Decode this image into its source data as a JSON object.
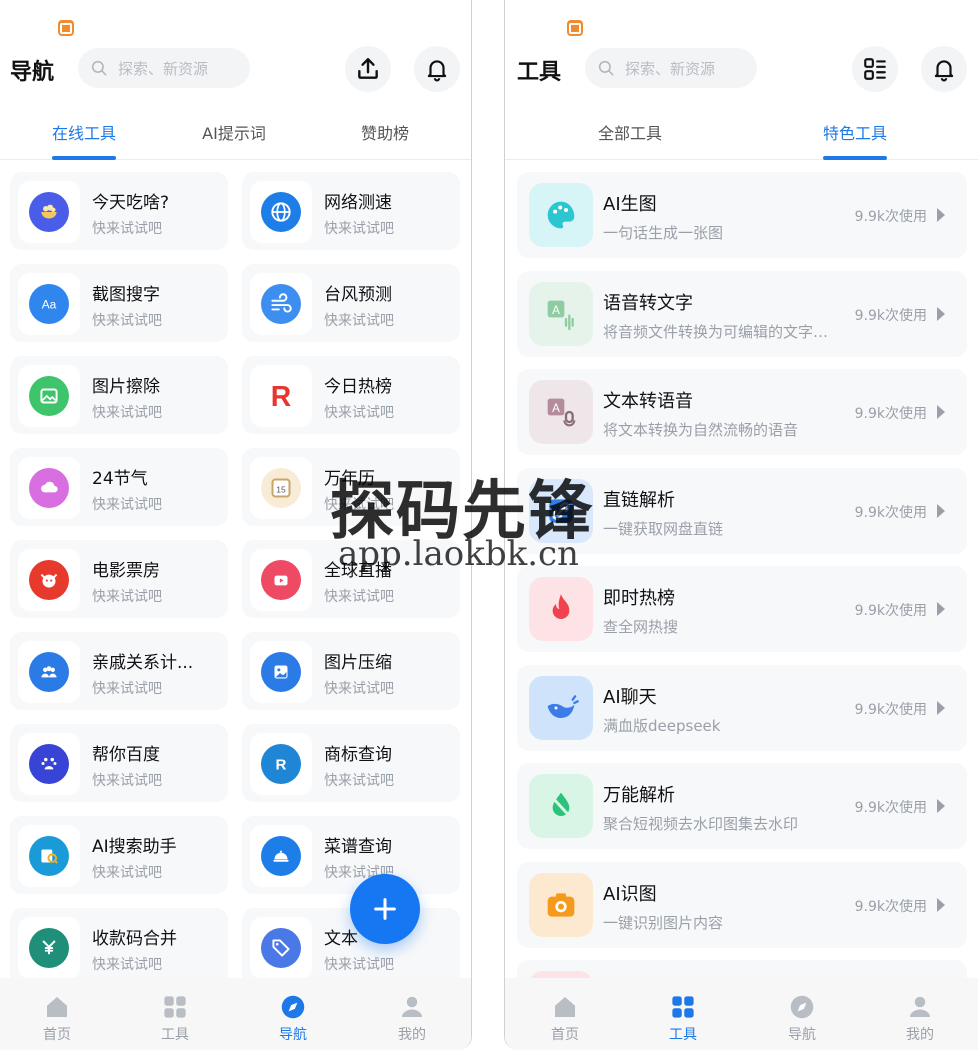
{
  "left": {
    "title": "导航",
    "search_placeholder": "探索、新资源",
    "tabs": [
      "在线工具",
      "AI提示词",
      "赞助榜"
    ],
    "active_tab": 0,
    "tools": [
      {
        "name": "今天吃啥?",
        "sub": "快来试试吧",
        "icon": "food-bowl-icon",
        "color": "#4a5de8"
      },
      {
        "name": "网络测速",
        "sub": "快来试试吧",
        "icon": "globe-icon",
        "color": "#1e7ee8"
      },
      {
        "name": "截图搜字",
        "sub": "快来试试吧",
        "icon": "text-aa-icon",
        "color": "#2f86ee"
      },
      {
        "name": "台风预测",
        "sub": "快来试试吧",
        "icon": "wind-icon",
        "color": "#3c8ef0"
      },
      {
        "name": "图片擦除",
        "sub": "快来试试吧",
        "icon": "image-erase-icon",
        "color": "#3ec46a"
      },
      {
        "name": "今日热榜",
        "sub": "快来试试吧",
        "icon": "r-logo-icon",
        "color": "#e8352d"
      },
      {
        "name": "24节气",
        "sub": "快来试试吧",
        "icon": "cloud-icon",
        "color": "#d86ee0"
      },
      {
        "name": "万年历",
        "sub": "快来试试吧",
        "icon": "calendar-icon",
        "color": "#f3e2c6"
      },
      {
        "name": "电影票房",
        "sub": "快来试试吧",
        "icon": "cat-logo-icon",
        "color": "#e83a2c"
      },
      {
        "name": "全球直播",
        "sub": "快来试试吧",
        "icon": "play-icon",
        "color": "#ef4a64"
      },
      {
        "name": "亲戚关系计...",
        "sub": "快来试试吧",
        "icon": "family-icon",
        "color": "#2a7be6"
      },
      {
        "name": "图片压缩",
        "sub": "快来试试吧",
        "icon": "image-compress-icon",
        "color": "#2a7be6"
      },
      {
        "name": "帮你百度",
        "sub": "快来试试吧",
        "icon": "baidu-paw-icon",
        "color": "#3844d6"
      },
      {
        "name": "商标查询",
        "sub": "快来试试吧",
        "icon": "registered-icon",
        "color": "#1f86d6"
      },
      {
        "name": "AI搜索助手",
        "sub": "快来试试吧",
        "icon": "ai-search-icon",
        "color": "#1a9bd8"
      },
      {
        "name": "菜谱查询",
        "sub": "快来试试吧",
        "icon": "cloche-icon",
        "color": "#1e7ee8"
      },
      {
        "name": "收款码合并",
        "sub": "快来试试吧",
        "icon": "yuan-download-icon",
        "color": "#1f8f7a"
      },
      {
        "name": "文本",
        "sub": "快来试试吧",
        "icon": "tag-icon",
        "color": "#4a78e6"
      }
    ],
    "nav": [
      {
        "label": "首页",
        "icon": "home-icon"
      },
      {
        "label": "工具",
        "icon": "grid-icon"
      },
      {
        "label": "导航",
        "icon": "compass-icon"
      },
      {
        "label": "我的",
        "icon": "user-icon"
      }
    ],
    "active_nav": 2
  },
  "right": {
    "title": "工具",
    "search_placeholder": "探索、新资源",
    "tabs": [
      "全部工具",
      "特色工具"
    ],
    "active_tab": 1,
    "tools": [
      {
        "name": "AI生图",
        "sub": "一句话生成一张图",
        "usage": "9.9k次使用",
        "icon": "palette-icon",
        "bg": "#d7f4f6",
        "color": "#2cc6d2"
      },
      {
        "name": "语音转文字",
        "sub": "将音频文件转换为可编辑的文字…",
        "usage": "9.9k次使用",
        "icon": "speech-to-text-icon",
        "bg": "#e6f3ea",
        "color": "#8fcca2"
      },
      {
        "name": "文本转语音",
        "sub": "将文本转换为自然流畅的语音",
        "usage": "9.9k次使用",
        "icon": "text-to-speech-icon",
        "bg": "#efe6ea",
        "color": "#b58c9c"
      },
      {
        "name": "直链解析",
        "sub": "一键获取网盘直链",
        "usage": "9.9k次使用",
        "icon": "link-icon",
        "bg": "#d9e8fb",
        "color": "#2f7ee8"
      },
      {
        "name": "即时热榜",
        "sub": "查全网热搜",
        "usage": "9.9k次使用",
        "icon": "flame-icon",
        "bg": "#fde3e5",
        "color": "#f0434f"
      },
      {
        "name": "AI聊天",
        "sub": "满血版deepseek",
        "usage": "9.9k次使用",
        "icon": "whale-icon",
        "bg": "#cfe3fb",
        "color": "#3d7be8"
      },
      {
        "name": "万能解析",
        "sub": "聚合短视频去水印图集去水印",
        "usage": "9.9k次使用",
        "icon": "no-drop-icon",
        "bg": "#d8f5e5",
        "color": "#2bc37a"
      },
      {
        "name": "AI识图",
        "sub": "一键识别图片内容",
        "usage": "9.9k次使用",
        "icon": "camera-icon",
        "bg": "#fde9cf",
        "color": "#f59a1c"
      }
    ],
    "nav": [
      {
        "label": "首页",
        "icon": "home-icon"
      },
      {
        "label": "工具",
        "icon": "grid-icon"
      },
      {
        "label": "导航",
        "icon": "compass-icon"
      },
      {
        "label": "我的",
        "icon": "user-icon"
      }
    ],
    "active_nav": 1
  },
  "watermark": {
    "title": "探码先锋",
    "url": "app.laokbk.cn"
  },
  "colors": {
    "accent": "#1e78e8",
    "muted": "#9aa0a8",
    "card_bg": "#f7f8fa"
  }
}
